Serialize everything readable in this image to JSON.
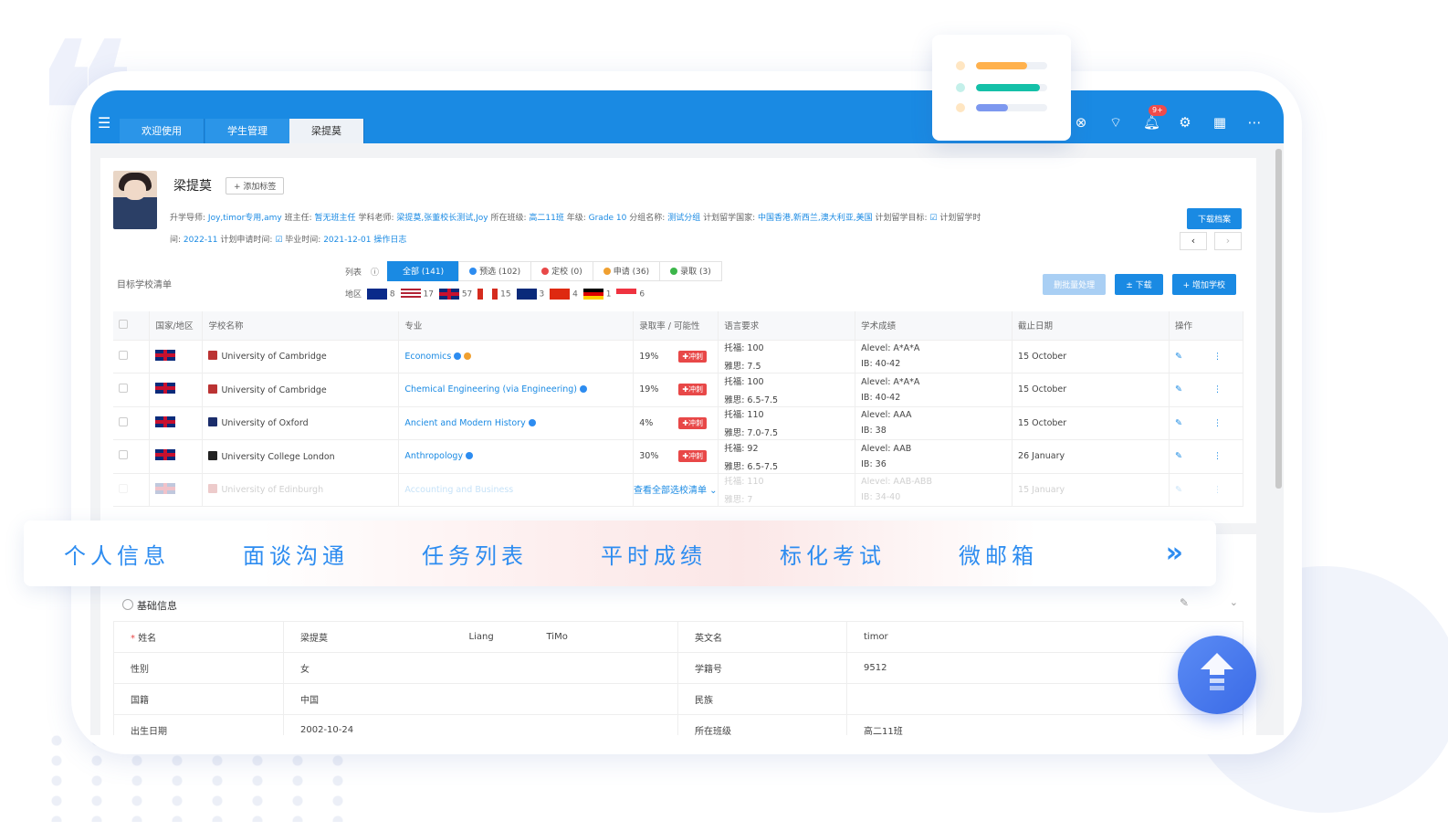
{
  "topbar": {
    "tabs": [
      "欢迎使用",
      "学生管理",
      "梁提莫"
    ],
    "badge": "9+"
  },
  "student": {
    "name": "梁提莫",
    "add_tag": "+ 添加标签",
    "line1": [
      {
        "label": "升学导师:",
        "value": "Joy,timor专用,amy"
      },
      {
        "label": "班主任:",
        "value": "暂无班主任"
      },
      {
        "label": "学科老师:",
        "value": "梁提莫,张董校长测试,Joy"
      },
      {
        "label": "所在班级:",
        "value": "高二11班"
      },
      {
        "label": "年级:",
        "value": "Grade 10"
      },
      {
        "label": "分组名称:",
        "value": "测试分组"
      },
      {
        "label": "计划留学国家:",
        "value": "中国香港,新西兰,澳大利亚,美国"
      },
      {
        "label": "计划留学目标:",
        "value": ""
      },
      {
        "label": "计划留学时",
        "value": ""
      }
    ],
    "line2": [
      {
        "label": "间:",
        "value": "2022-11"
      },
      {
        "label": "计划申请时间:",
        "value": ""
      },
      {
        "label": "毕业时间:",
        "value": "2021-12-01"
      },
      {
        "label": "",
        "value": "操作日志"
      }
    ],
    "download_profile": "下载档案"
  },
  "schoollist": {
    "title": "目标学校清单",
    "filter_label": "列表",
    "filters": [
      {
        "label": "全部 (141)",
        "color": ""
      },
      {
        "label": "预选 (102)",
        "color": "#2d8cf0"
      },
      {
        "label": "定校 (0)",
        "color": "#e84848"
      },
      {
        "label": "申请 (36)",
        "color": "#f0a030"
      },
      {
        "label": "录取 (3)",
        "color": "#3cb64a"
      }
    ],
    "region_label": "地区",
    "regions": [
      "8",
      "17",
      "57",
      "15",
      "3",
      "4",
      "1",
      "6"
    ],
    "actions": [
      "删批量处理",
      "± 下载",
      "+ 增加学校"
    ],
    "columns": [
      "国家/地区",
      "学校名称",
      "专业",
      "录取率 / 可能性",
      "语言要求",
      "学术成绩",
      "截止日期",
      "操作"
    ],
    "rows": [
      {
        "school": "University of Cambridge",
        "major": "Economics",
        "rate": "19%",
        "tag": "冲刺",
        "lang1": "托福: 100",
        "lang2": "雅思: 7.5",
        "acad1": "Alevel: A*A*A",
        "acad2": "IB: 40-42",
        "deadline": "15 October"
      },
      {
        "school": "University of Cambridge",
        "major": "Chemical Engineering (via Engineering)",
        "rate": "19%",
        "tag": "冲刺",
        "lang1": "托福: 100",
        "lang2": "雅思: 6.5-7.5",
        "acad1": "Alevel: A*A*A",
        "acad2": "IB: 40-42",
        "deadline": "15 October"
      },
      {
        "school": "University of Oxford",
        "major": "Ancient and Modern History",
        "rate": "4%",
        "tag": "冲刺",
        "lang1": "托福: 110",
        "lang2": "雅思: 7.0-7.5",
        "acad1": "Alevel: AAA",
        "acad2": "IB: 38",
        "deadline": "15 October"
      },
      {
        "school": "University College London",
        "major": "Anthropology",
        "rate": "30%",
        "tag": "冲刺",
        "lang1": "托福: 92",
        "lang2": "雅思: 6.5-7.5",
        "acad1": "Alevel: AAB",
        "acad2": "IB: 36",
        "deadline": "26 January"
      },
      {
        "school": "University of Edinburgh",
        "major": "Accounting and Business",
        "rate": "",
        "tag": "",
        "lang1": "托福: 110",
        "lang2": "雅思: 7",
        "acad1": "Alevel: AAB-ABB",
        "acad2": "IB: 34-40",
        "deadline": "15 January"
      }
    ],
    "view_all": "查看全部选校清单 ⌄"
  },
  "basic": {
    "title": "基础信息",
    "rows": [
      [
        "姓名",
        "梁提莫",
        "Liang",
        "TiMo",
        "英文名",
        "timor"
      ],
      [
        "性别",
        "女",
        "",
        "",
        "学籍号",
        "9512"
      ],
      [
        "国籍",
        "中国",
        "",
        "",
        "民族",
        ""
      ],
      [
        "出生日期",
        "2002-10-24",
        "",
        "",
        "所在班级",
        "高二11班"
      ]
    ]
  },
  "banner": {
    "items": [
      "个人信息",
      "面谈沟通",
      "任务列表",
      "平时成绩",
      "标化考试",
      "微邮箱"
    ],
    "more": "»"
  },
  "float_card": {
    "bars": [
      {
        "color": "#ffb14d",
        "dot": "#ffe6c2",
        "fill": 0.72
      },
      {
        "color": "#14c0a8",
        "dot": "#c4f0ea",
        "fill": 0.9
      },
      {
        "color": "#7d98ef",
        "dot": "#ffe6c2",
        "fill": 0.45
      }
    ]
  },
  "colors": {
    "primary": "#1a8ae3",
    "accent": "#2d8cf0",
    "danger": "#e84848"
  }
}
